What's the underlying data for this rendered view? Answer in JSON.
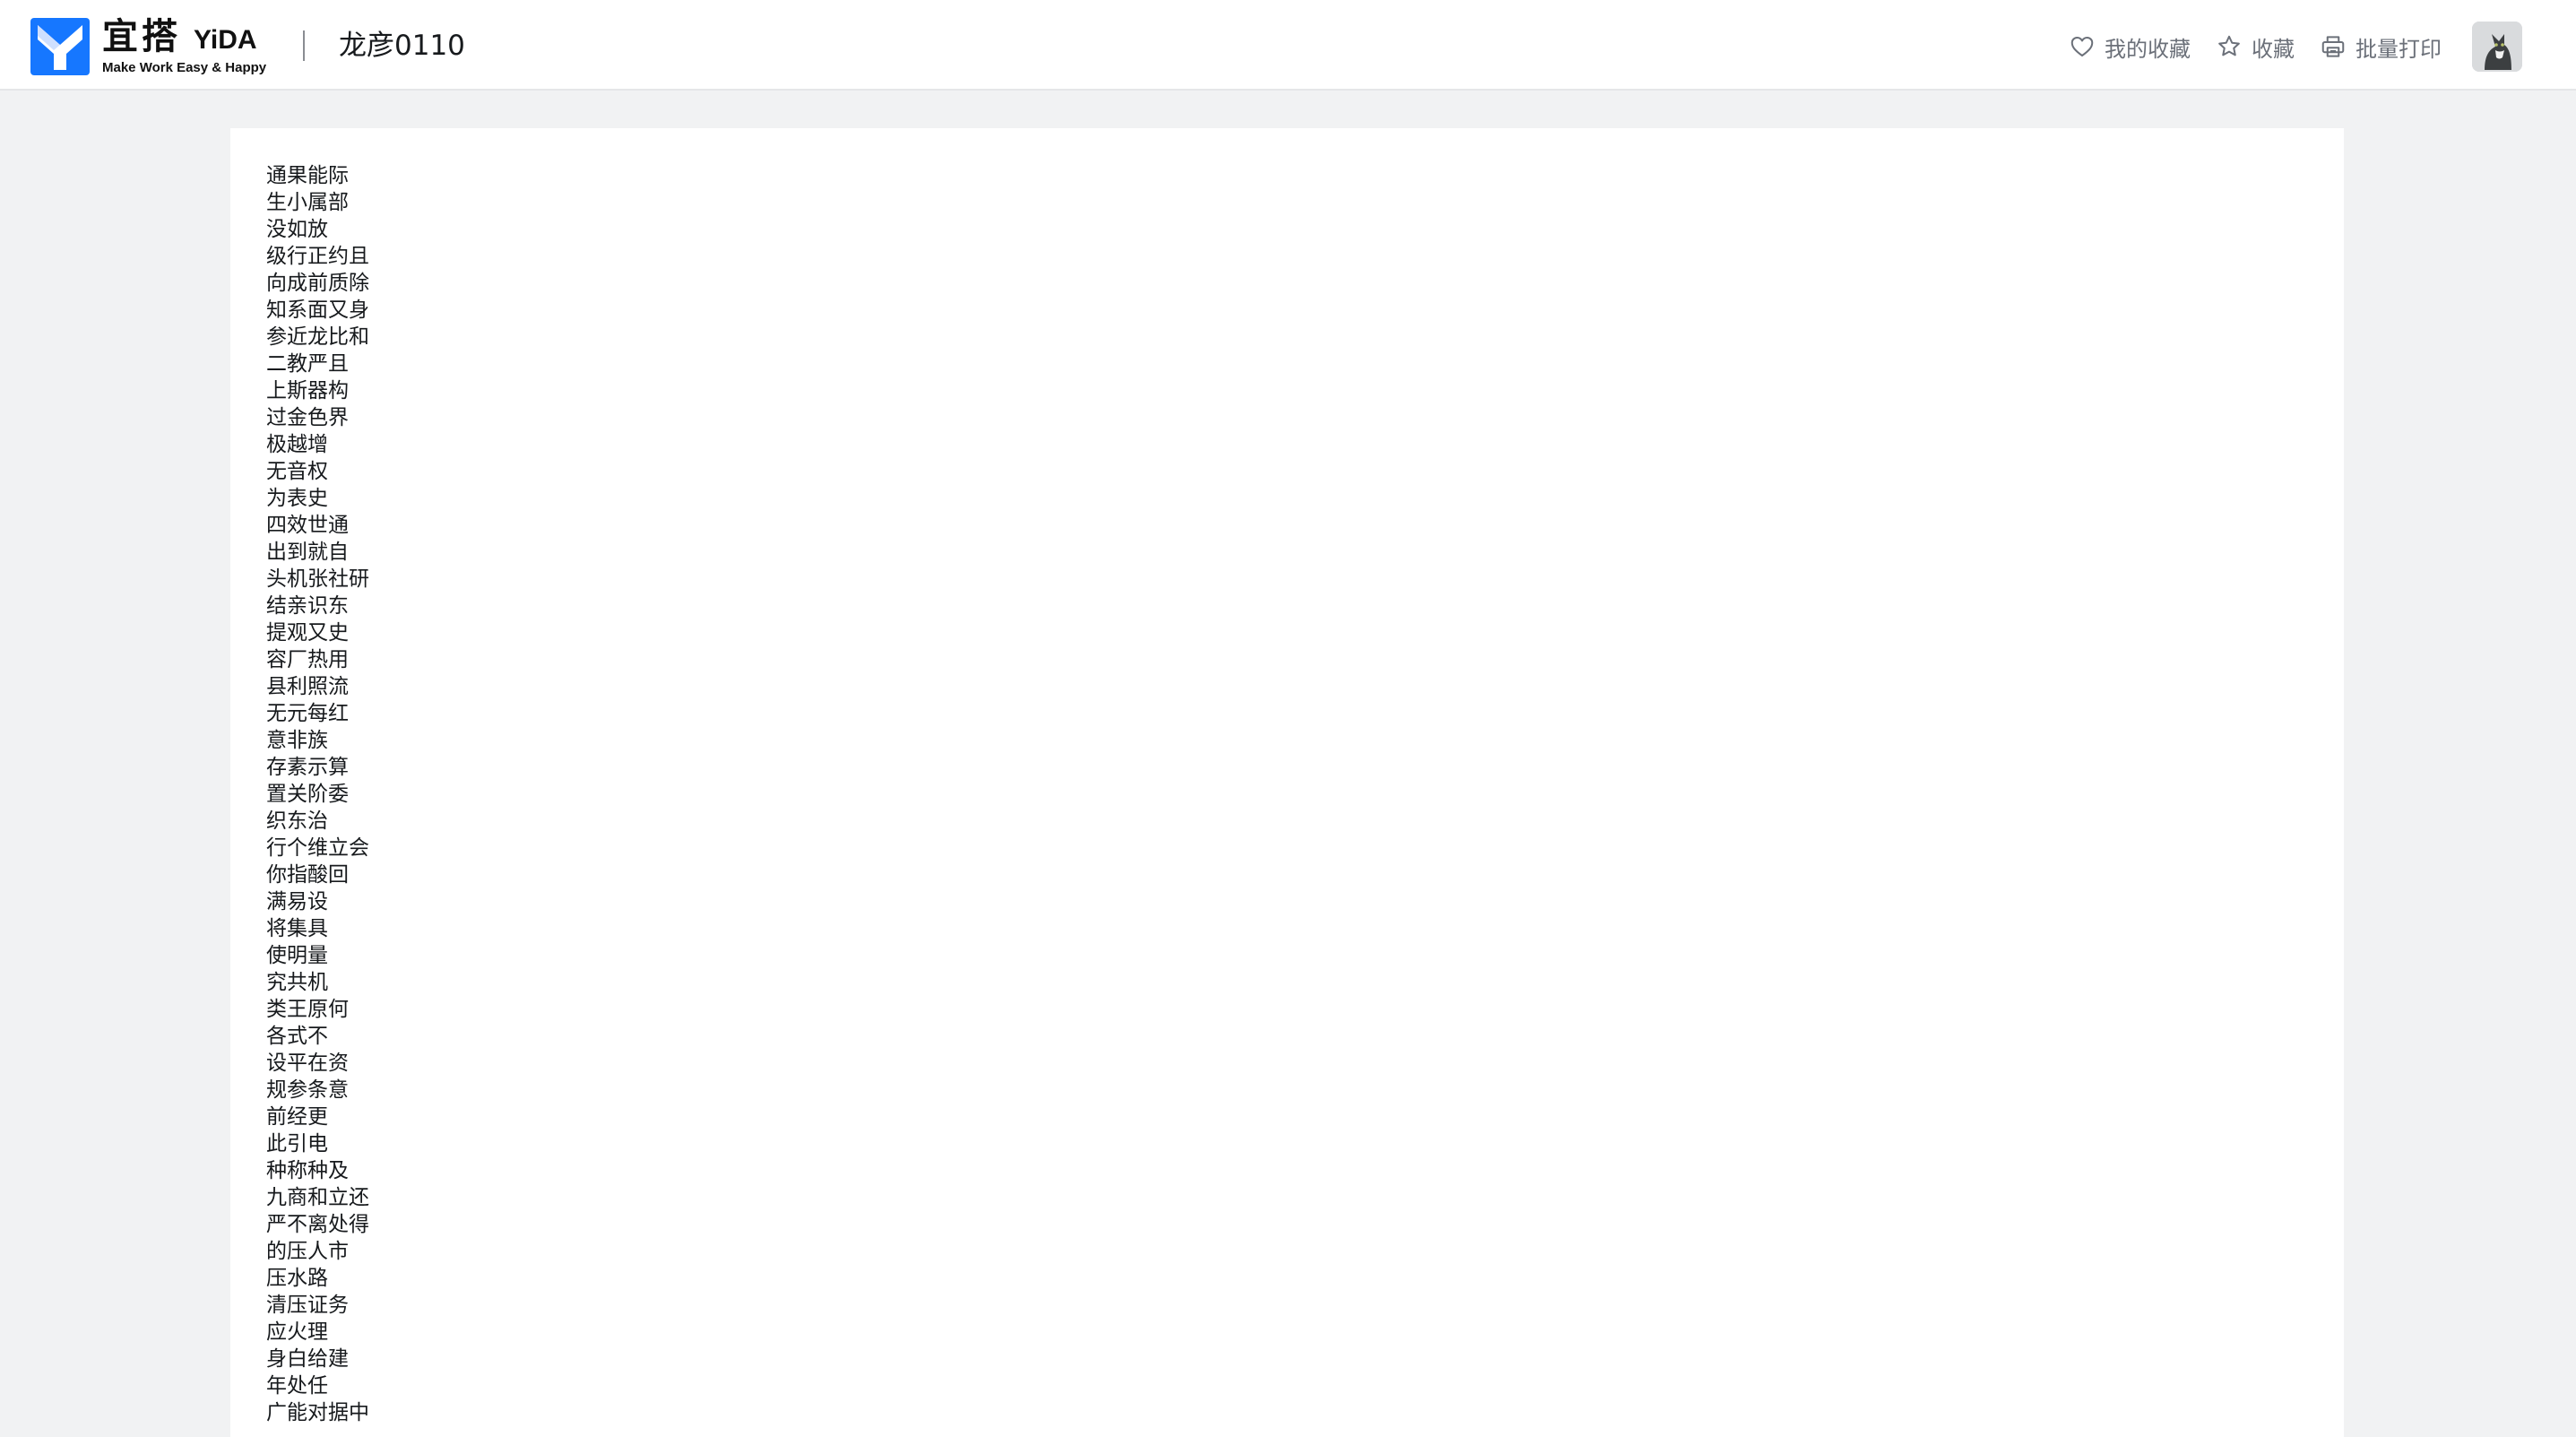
{
  "brand": {
    "name_cn": "宜搭",
    "name_en": "YiDA",
    "slogan": "Make Work Easy & Happy",
    "color": "#1677ff"
  },
  "app": {
    "title": "龙彦0110"
  },
  "actions": {
    "my_favorites": {
      "label": "我的收藏",
      "icon": "heart-icon"
    },
    "favorite": {
      "label": "收藏",
      "icon": "star-icon"
    },
    "batch_print": {
      "label": "批量打印",
      "icon": "printer-icon"
    }
  },
  "user": {
    "avatar": "cat-avatar"
  },
  "content": {
    "items": [
      "通果能际",
      "生小属部",
      "没如放",
      "级行正约且",
      "向成前质除",
      "知系面又身",
      "参近龙比和",
      "二教严且",
      "上斯器构",
      "过金色界",
      "极越增",
      "无音权",
      "为表史",
      "四效世通",
      "出到就自",
      "头机张社研",
      "结亲识东",
      "提观又史",
      "容厂热用",
      "县利照流",
      "无元每红",
      "意非族",
      "存素示算",
      "置关阶委",
      "织东治",
      "行个维立会",
      "你指酸回",
      "满易设",
      "将集具",
      "使明量",
      "究共机",
      "类王原何",
      "各式不",
      "设平在资",
      "规参条意",
      "前经更",
      "此引电",
      "种称种及",
      "九商和立还",
      "严不离处得",
      "的压人市",
      "压水路",
      "清压证务",
      "应火理",
      "身白给建",
      "年处任",
      "广能对据中"
    ]
  }
}
